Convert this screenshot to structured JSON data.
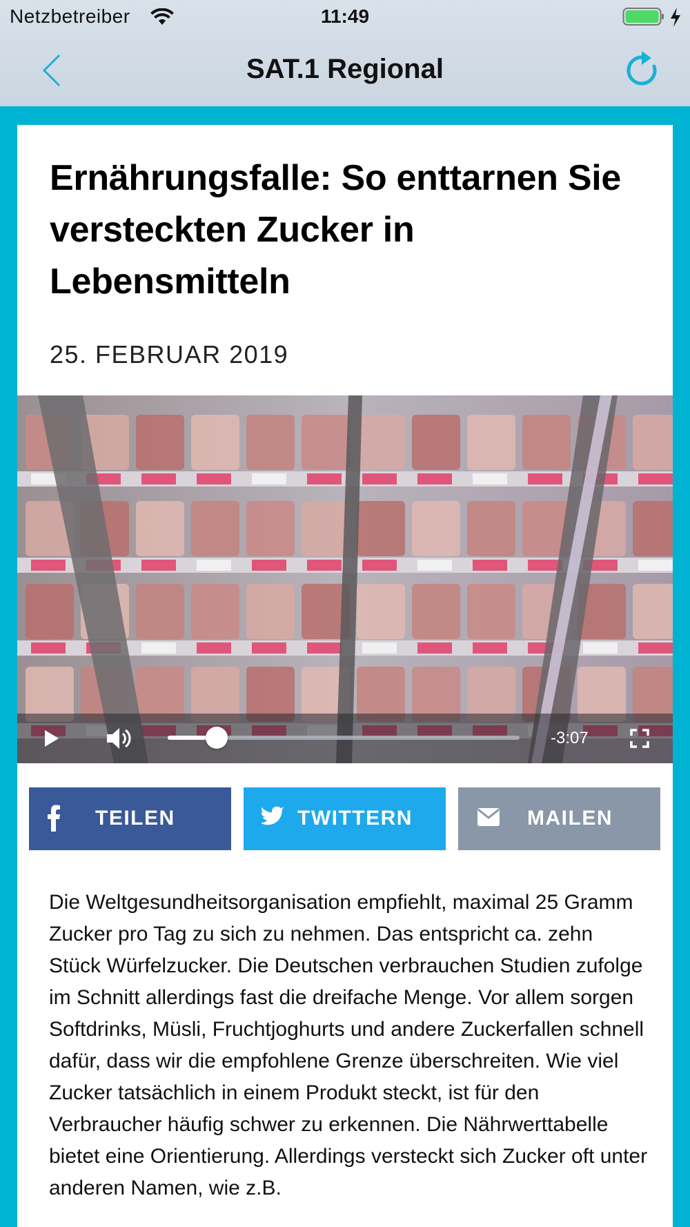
{
  "status_bar": {
    "carrier": "Netzbetreiber",
    "time": "11:49"
  },
  "nav": {
    "title": "SAT.1 Regional",
    "back_icon": "chevron-left-icon",
    "refresh_icon": "refresh-icon",
    "accent_color": "#1ab0d6"
  },
  "article": {
    "headline": "Ernährungsfalle: So enttarnen Sie versteckten Zucker in Lebensmitteln",
    "date": "25. FEBRUAR 2019",
    "video": {
      "time_remaining": "-3:07",
      "progress": 0.14
    },
    "share": {
      "facebook_label": "TEILEN",
      "twitter_label": "TWITTERN",
      "mail_label": "MAILEN",
      "facebook_color": "#3a5998",
      "twitter_color": "#1da9ec",
      "mail_color": "#8a97a9"
    },
    "body": "Die Weltgesundheitsorganisation empfiehlt, maximal 25 Gramm Zucker pro Tag zu sich zu nehmen. Das entspricht ca. zehn Stück Würfelzucker. Die Deutschen verbrauchen Studien zufolge im Schnitt allerdings fast die dreifache Menge. Vor allem sorgen Softdrinks, Müsli, Fruchtjoghurts und andere Zuckerfallen schnell dafür, dass wir die empfohlene Grenze überschreiten. Wie viel Zucker tatsächlich in einem Produkt steckt, ist für den Verbraucher häufig schwer zu erkennen. Die Nährwerttabelle bietet eine Orientierung. Allerdings versteckt sich Zucker oft unter anderen Namen, wie z.B."
  },
  "background_color": "#00b3d3"
}
